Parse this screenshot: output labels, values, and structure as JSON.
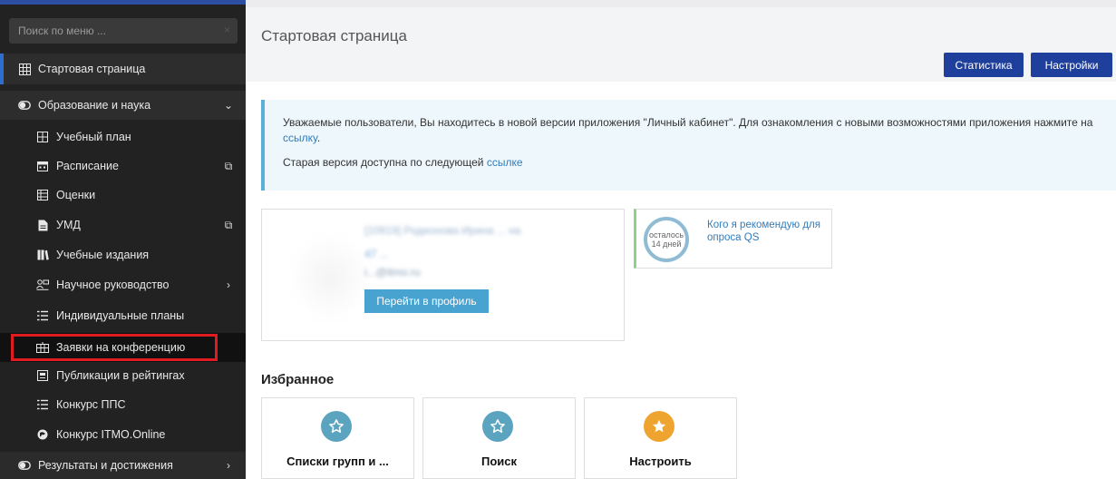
{
  "sidebar": {
    "search_placeholder": "Поиск по меню ...",
    "search_clear": "×",
    "items": [
      {
        "label": "Стартовая страница",
        "icon": "grid-icon"
      },
      {
        "label": "Образование и наука",
        "icon": "toggle-icon",
        "trail": "⌄"
      },
      {
        "label": "Учебный план",
        "icon": "grid-icon"
      },
      {
        "label": "Расписание",
        "icon": "calendar-icon",
        "trail": "⧉"
      },
      {
        "label": "Оценки",
        "icon": "table-icon"
      },
      {
        "label": "УМД",
        "icon": "document-icon",
        "trail": "⧉"
      },
      {
        "label": "Учебные издания",
        "icon": "books-icon"
      },
      {
        "label": "Научное руководство",
        "icon": "supervisor-icon",
        "trail": "›"
      },
      {
        "label": "Индивидуальные планы",
        "icon": "list-icon"
      },
      {
        "label": "Заявки на конференцию",
        "icon": "conference-icon"
      },
      {
        "label": "Публикации в рейтингах",
        "icon": "publication-icon"
      },
      {
        "label": "Конкурс ППС",
        "icon": "list-icon"
      },
      {
        "label": "Конкурс ITMO.Online",
        "icon": "globe-icon"
      },
      {
        "label": "Результаты и достижения",
        "icon": "toggle-icon",
        "trail": "›"
      }
    ]
  },
  "header": {
    "title": "Стартовая страница",
    "stats_label": "Статистика",
    "settings_label": "Настройки"
  },
  "notice": {
    "line1": "Уважаемые пользователи, Вы находитесь в новой версии приложения \"Личный кабинет\". Для ознакомления с новыми возможностями приложения нажмите на",
    "link1": "ссылку",
    "line1_end": ".",
    "line2": "Старая версия доступна по следующей",
    "link2": "ссылке"
  },
  "profile": {
    "name_blurred": "[10919] Родионова Ирина ... на",
    "meta_blurred": "47 ...",
    "email_blurred": "i...@itmo.ru",
    "button_label": "Перейти в профиль"
  },
  "qs": {
    "remaining_top": "осталось",
    "remaining_days": "14 дней",
    "text": "Кого я рекомендую для опроса QS"
  },
  "favorites": {
    "title": "Избранное",
    "items": [
      {
        "label": "Списки групп и ...",
        "icon": "star-icon",
        "color": "#5ba4bf"
      },
      {
        "label": "Поиск",
        "icon": "star-icon",
        "color": "#5ba4bf"
      },
      {
        "label": "Настроить",
        "icon": "star-icon",
        "color": "#f0a430"
      }
    ]
  },
  "colors": {
    "sidebar_bg": "#222222",
    "accent_blue": "#1f3f9d",
    "highlight_red": "#e11b22"
  }
}
